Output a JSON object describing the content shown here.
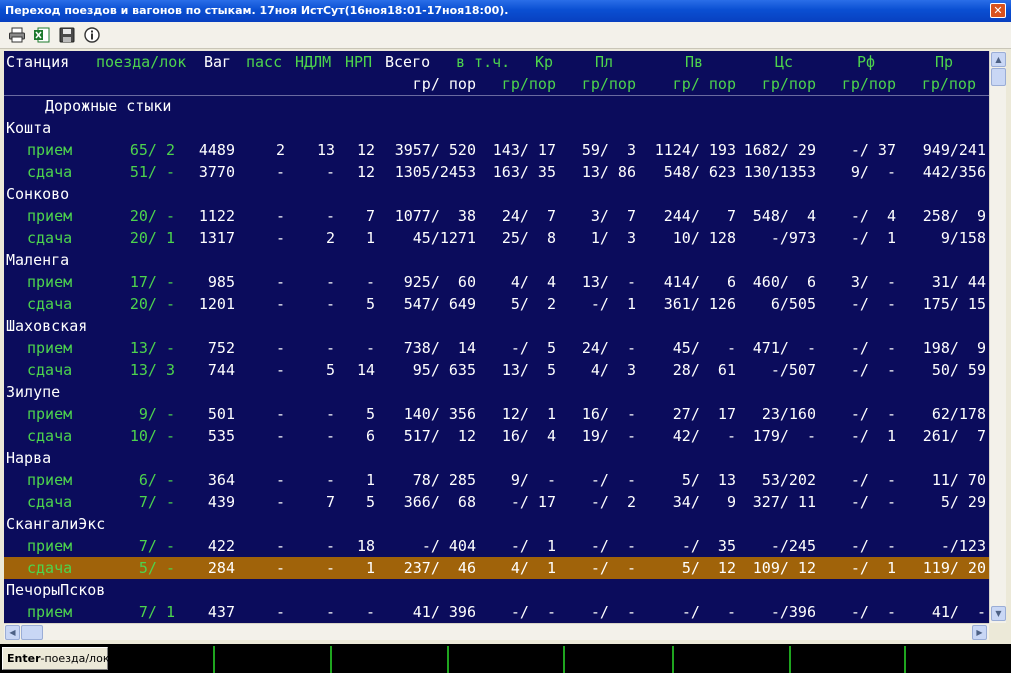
{
  "window": {
    "title": "Переход поездов и вагонов по стыкам. 17ноя ИстСут(16ноя18:01-17ноя18:00).",
    "close_symbol": "✕"
  },
  "toolbar": {
    "buttons": [
      {
        "name": "print-icon"
      },
      {
        "name": "excel-export-icon"
      },
      {
        "name": "save-icon"
      },
      {
        "name": "info-icon"
      }
    ]
  },
  "table": {
    "header_row1": [
      "Станция",
      "поезда/лок",
      "Ваг",
      "пасс",
      "НДЛМ",
      "НРП",
      "Всего",
      "в т.ч.",
      "Кр",
      "Пл",
      "Пв",
      "Цс",
      "Рф",
      "Пр"
    ],
    "header_row2": [
      "гр/ пор",
      "гр/пор",
      "гр/пор",
      "гр/ пор",
      "гр/пор",
      "гр/пор",
      "гр/пор"
    ],
    "section_label": "Дорожные стыки",
    "rows": [
      {
        "type": "station",
        "name": "Кошта"
      },
      {
        "type": "data",
        "label": "прием",
        "cells": [
          "65/ 2",
          "4489",
          "2",
          "13",
          "12",
          "3957/ 520",
          "143/ 17",
          "59/  3",
          "1124/ 193",
          "1682/ 29",
          "-/ 37",
          "949/241"
        ]
      },
      {
        "type": "data",
        "label": "сдача",
        "cells": [
          "51/ -",
          "3770",
          "-",
          "-",
          "12",
          "1305/2453",
          "163/ 35",
          "13/ 86",
          "548/ 623",
          "130/1353",
          "9/  -",
          "442/356"
        ]
      },
      {
        "type": "station",
        "name": "Сонково"
      },
      {
        "type": "data",
        "label": "прием",
        "cells": [
          "20/ -",
          "1122",
          "-",
          "-",
          "7",
          "1077/  38",
          "24/  7",
          "3/  7",
          "244/   7",
          "548/  4",
          "-/  4",
          "258/  9"
        ]
      },
      {
        "type": "data",
        "label": "сдача",
        "cells": [
          "20/ 1",
          "1317",
          "-",
          "2",
          "1",
          "45/1271",
          "25/  8",
          "1/  3",
          "10/ 128",
          "-/973",
          "-/  1",
          "9/158"
        ]
      },
      {
        "type": "station",
        "name": "Маленга"
      },
      {
        "type": "data",
        "label": "прием",
        "cells": [
          "17/ -",
          "985",
          "-",
          "-",
          "-",
          "925/  60",
          "4/  4",
          "13/  -",
          "414/   6",
          "460/  6",
          "3/  -",
          "31/ 44"
        ]
      },
      {
        "type": "data",
        "label": "сдача",
        "cells": [
          "20/ -",
          "1201",
          "-",
          "-",
          "5",
          "547/ 649",
          "5/  2",
          "-/  1",
          "361/ 126",
          "6/505",
          "-/  -",
          "175/ 15"
        ]
      },
      {
        "type": "station",
        "name": "Шаховская"
      },
      {
        "type": "data",
        "label": "прием",
        "cells": [
          "13/ -",
          "752",
          "-",
          "-",
          "-",
          "738/  14",
          "-/  5",
          "24/  -",
          "45/   -",
          "471/  -",
          "-/  -",
          "198/  9"
        ]
      },
      {
        "type": "data",
        "label": "сдача",
        "cells": [
          "13/ 3",
          "744",
          "-",
          "5",
          "14",
          "95/ 635",
          "13/  5",
          "4/  3",
          "28/  61",
          "-/507",
          "-/  -",
          "50/ 59"
        ]
      },
      {
        "type": "station",
        "name": "Зилупе"
      },
      {
        "type": "data",
        "label": "прием",
        "cells": [
          "9/ -",
          "501",
          "-",
          "-",
          "5",
          "140/ 356",
          "12/  1",
          "16/  -",
          "27/  17",
          "23/160",
          "-/  -",
          "62/178"
        ]
      },
      {
        "type": "data",
        "label": "сдача",
        "cells": [
          "10/ -",
          "535",
          "-",
          "-",
          "6",
          "517/  12",
          "16/  4",
          "19/  -",
          "42/   -",
          "179/  -",
          "-/  1",
          "261/  7"
        ]
      },
      {
        "type": "station",
        "name": "Нарва"
      },
      {
        "type": "data",
        "label": "прием",
        "cells": [
          "6/ -",
          "364",
          "-",
          "-",
          "1",
          "78/ 285",
          "9/  -",
          "-/  -",
          "5/  13",
          "53/202",
          "-/  -",
          "11/ 70"
        ]
      },
      {
        "type": "data",
        "label": "сдача",
        "cells": [
          "7/ -",
          "439",
          "-",
          "7",
          "5",
          "366/  68",
          "-/ 17",
          "-/  2",
          "34/   9",
          "327/ 11",
          "-/  -",
          "5/ 29"
        ]
      },
      {
        "type": "station",
        "name": "СкангалиЭкс"
      },
      {
        "type": "data",
        "label": "прием",
        "cells": [
          "7/ -",
          "422",
          "-",
          "-",
          "18",
          "-/ 404",
          "-/  1",
          "-/  -",
          "-/  35",
          "-/245",
          "-/  -",
          "-/123"
        ]
      },
      {
        "type": "data",
        "label": "сдача",
        "selected": true,
        "cells": [
          "5/ -",
          "284",
          "-",
          "-",
          "1",
          "237/  46",
          "4/  1",
          "-/  -",
          "5/  12",
          "109/ 12",
          "-/  1",
          "119/ 20"
        ]
      },
      {
        "type": "station",
        "name": "ПечорыПсков"
      },
      {
        "type": "data",
        "label": "прием",
        "cells": [
          "7/ 1",
          "437",
          "-",
          "-",
          "-",
          "41/ 396",
          "-/  -",
          "-/  -",
          "-/   -",
          "-/396",
          "-/  -",
          "41/  -"
        ]
      }
    ]
  },
  "colors": {
    "background": "#0b0c5c",
    "green_text": "#4dd44d",
    "white_text": "#ffffff",
    "selected_row": "#a0630a"
  },
  "statusbar": {
    "key": "Enter",
    "hint": "-поезда/лок"
  }
}
